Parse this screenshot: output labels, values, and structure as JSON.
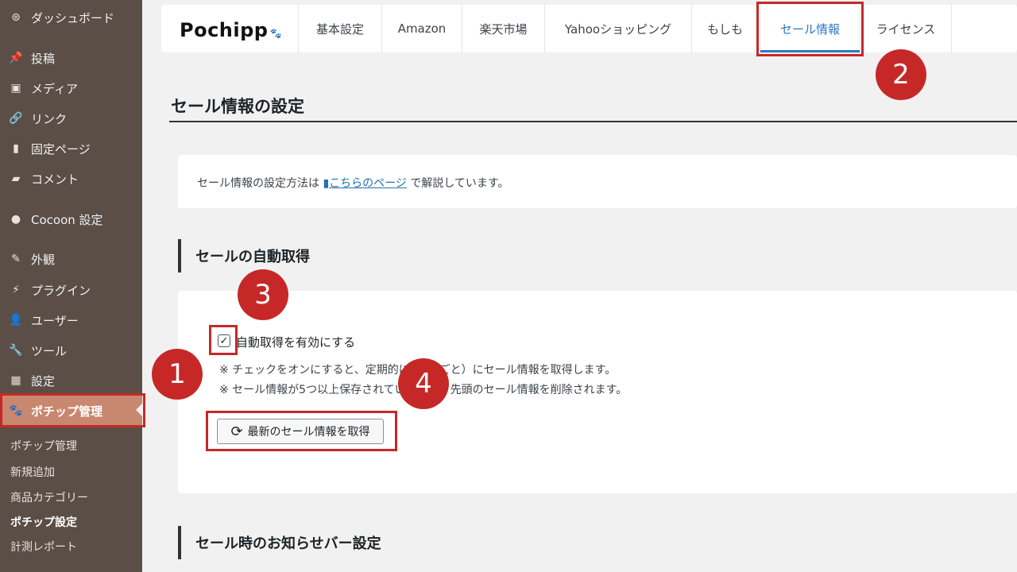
{
  "sidebar": {
    "items": [
      {
        "label": "ダッシュボード",
        "icon": "dashboard-icon",
        "glyph": "⊛"
      },
      {
        "label": "投稿",
        "icon": "pin-icon",
        "glyph": "📌"
      },
      {
        "label": "メディア",
        "icon": "media-icon",
        "glyph": "▣"
      },
      {
        "label": "リンク",
        "icon": "link-icon",
        "glyph": "🔗"
      },
      {
        "label": "固定ページ",
        "icon": "page-icon",
        "glyph": "▮"
      },
      {
        "label": "コメント",
        "icon": "comment-icon",
        "glyph": "▰"
      },
      {
        "label": "Cocoon 設定",
        "icon": "circle-icon",
        "glyph": "●"
      },
      {
        "label": "外観",
        "icon": "appearance-icon",
        "glyph": "✎"
      },
      {
        "label": "プラグイン",
        "icon": "plugin-icon",
        "glyph": "⚡"
      },
      {
        "label": "ユーザー",
        "icon": "user-icon",
        "glyph": "👤"
      },
      {
        "label": "ツール",
        "icon": "wrench-icon",
        "glyph": "🔧"
      },
      {
        "label": "設定",
        "icon": "settings-icon",
        "glyph": "▦"
      },
      {
        "label": "ポチップ管理",
        "icon": "paw-icon",
        "glyph": "🐾"
      }
    ],
    "submenu": [
      {
        "label": "ポチップ管理"
      },
      {
        "label": "新規追加"
      },
      {
        "label": "商品カテゴリー"
      },
      {
        "label": "ポチップ設定"
      },
      {
        "label": "計測レポート"
      }
    ]
  },
  "tabbar": {
    "logo": "Pochipp",
    "tabs": [
      {
        "label": "基本設定"
      },
      {
        "label": "Amazon"
      },
      {
        "label": "楽天市場"
      },
      {
        "label": "Yahooショッピング"
      },
      {
        "label": "もしも"
      },
      {
        "label": "セール情報"
      },
      {
        "label": "ライセンス"
      }
    ]
  },
  "main": {
    "title": "セール情報の設定",
    "info": {
      "prefix": "セール情報の設定方法は ",
      "link": "こちらのページ",
      "suffix": " で解説しています。"
    },
    "section1": {
      "heading": "セールの自動取得",
      "checkbox_label": "自動取得を有効にする",
      "checkbox_checked": true,
      "note1": "※ チェックをオンにすると、定期的に（1日ごと）にセール情報を取得します。",
      "note2": "※ セール情報が5つ以上保存されている場合、先頭のセール情報を削除されます。",
      "button": "最新のセール情報を取得"
    },
    "section2": {
      "heading": "セール時のお知らせバー設定"
    }
  },
  "annotations": {
    "badges": [
      "1",
      "2",
      "3",
      "4"
    ],
    "color": "#c62828"
  },
  "colors": {
    "sidebar_bg": "#5a4e47",
    "sidebar_active": "#c8876f",
    "accent_blue": "#2e78c7"
  }
}
